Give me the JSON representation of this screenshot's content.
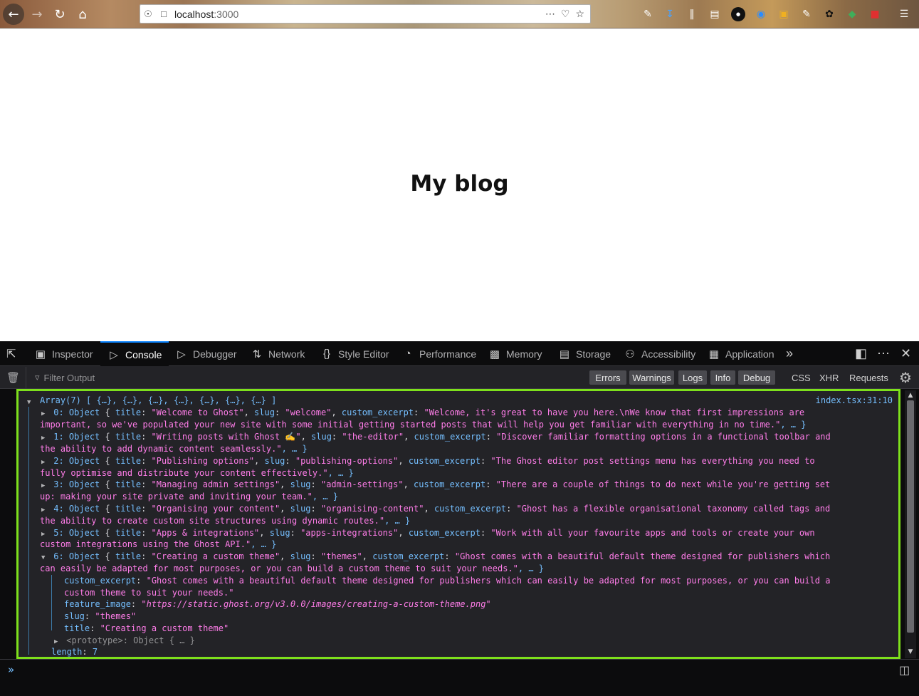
{
  "browser": {
    "url_host": "localhost",
    "url_port": ":3000"
  },
  "page": {
    "title": "My blog"
  },
  "devtools": {
    "tabs": [
      {
        "label": "Inspector",
        "icon": "inspector-icon"
      },
      {
        "label": "Console",
        "icon": "console-icon"
      },
      {
        "label": "Debugger",
        "icon": "debugger-icon"
      },
      {
        "label": "Network",
        "icon": "network-icon"
      },
      {
        "label": "Style Editor",
        "icon": "style-editor-icon"
      },
      {
        "label": "Performance",
        "icon": "performance-icon"
      },
      {
        "label": "Memory",
        "icon": "memory-icon"
      },
      {
        "label": "Storage",
        "icon": "storage-icon"
      },
      {
        "label": "Accessibility",
        "icon": "accessibility-icon"
      },
      {
        "label": "Application",
        "icon": "application-icon"
      }
    ],
    "active_tab": "Console",
    "filter_placeholder": "Filter Output",
    "levels": [
      "Errors",
      "Warnings",
      "Logs",
      "Info",
      "Debug"
    ],
    "requests": [
      "CSS",
      "XHR",
      "Requests"
    ],
    "log_source": "index.tsx:31:10",
    "colors": {
      "accent": "#0a84ff",
      "highlight_border": "#7ee01c",
      "key": "#75bfff",
      "string": "#ff7de9"
    }
  },
  "console": {
    "header": "Array(7) [ {…}, {…}, {…}, {…}, {…}, {…}, {…} ]",
    "items": [
      {
        "index": "0",
        "title": "\"Welcome to Ghost\"",
        "slug": "\"welcome\"",
        "excerpt_line1": "\"Welcome, it's great to have you here.\\nWe know that first impressions are",
        "excerpt_line2": "important, so we've populated your new site with some initial getting started posts that will help you get familiar with everything in no time.\"",
        "tail": ", … }"
      },
      {
        "index": "1",
        "title": "\"Writing posts with Ghost ✍️\"",
        "slug": "\"the-editor\"",
        "excerpt_line1": "\"Discover familiar formatting options in a functional toolbar and",
        "excerpt_line2": "the ability to add dynamic content seamlessly.\"",
        "tail": ", … }"
      },
      {
        "index": "2",
        "title": "\"Publishing options\"",
        "slug": "\"publishing-options\"",
        "excerpt_line1": "\"The Ghost editor post settings menu has everything you need to",
        "excerpt_line2": "fully optimise and distribute your content effectively.\"",
        "tail": ", … }"
      },
      {
        "index": "3",
        "title": "\"Managing admin settings\"",
        "slug": "\"admin-settings\"",
        "excerpt_line1": "\"There are a couple of things to do next while you're getting set",
        "excerpt_line2": "up: making your site private and inviting your team.\"",
        "tail": ", … }"
      },
      {
        "index": "4",
        "title": "\"Organising your content\"",
        "slug": "\"organising-content\"",
        "excerpt_line1": "\"Ghost has a flexible organisational taxonomy called tags and",
        "excerpt_line2": "the ability to create custom site structures using dynamic routes.\"",
        "tail": ", … }"
      },
      {
        "index": "5",
        "title": "\"Apps & integrations\"",
        "slug": "\"apps-integrations\"",
        "excerpt_line1": "\"Work with all your favourite apps and tools or create your own",
        "excerpt_line2": "custom integrations using the Ghost API.\"",
        "tail": ", … }"
      },
      {
        "index": "6",
        "title": "\"Creating a custom theme\"",
        "slug": "\"themes\"",
        "excerpt_line1": "\"Ghost comes with a beautiful default theme designed for publishers which",
        "excerpt_line2": "can easily be adapted for most purposes, or you can build a custom theme to suit your needs.\"",
        "tail": ", … }"
      }
    ],
    "expanded": {
      "custom_excerpt_line1": "\"Ghost comes with a beautiful default theme designed for publishers which can easily be adapted for most purposes, or you can build a",
      "custom_excerpt_line2": "custom theme to suit your needs.\"",
      "feature_image": "\"https://static.ghost.org/v3.0.0/images/creating-a-custom-theme.png\"",
      "slug": "\"themes\"",
      "title": "\"Creating a custom theme\"",
      "prototype": "Object { … }",
      "length": "7"
    },
    "labels": {
      "object": "Object",
      "title_key": "title",
      "slug_key": "slug",
      "excerpt_key": "custom_excerpt",
      "feature_key": "feature_image",
      "prototype_key": "<prototype>",
      "length_key": "length"
    }
  }
}
